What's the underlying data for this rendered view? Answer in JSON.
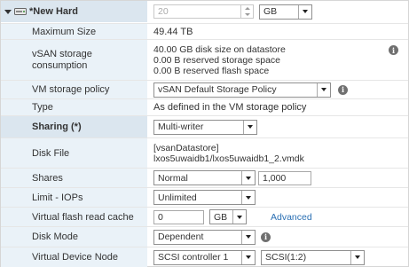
{
  "disk": {
    "title": "*New Hard",
    "size_value": "20",
    "size_unit": "GB"
  },
  "rows": {
    "max_size": {
      "label": "Maximum Size",
      "value": "49.44 TB"
    },
    "vsan": {
      "label_line1": "vSAN storage",
      "label_line2": "consumption",
      "line1": "40.00 GB disk size on datastore",
      "line2": "0.00 B reserved storage space",
      "line3": "0.00 B reserved flash space"
    },
    "policy": {
      "label": "VM storage policy",
      "value": "vSAN Default Storage Policy"
    },
    "type": {
      "label": "Type",
      "value": "As defined in the VM storage policy"
    },
    "sharing": {
      "label": "Sharing (*)",
      "value": "Multi-writer"
    },
    "disk_file": {
      "label": "Disk File",
      "line1": "[vsanDatastore]",
      "line2": "lxos5uwaidb1/lxos5uwaidb1_2.vmdk"
    },
    "shares": {
      "label": "Shares",
      "value": "Normal",
      "amount": "1,000"
    },
    "limit_iops": {
      "label": "Limit - IOPs",
      "value": "Unlimited"
    },
    "flash_cache": {
      "label": "Virtual flash read cache",
      "value": "0",
      "unit": "GB",
      "link": "Advanced"
    },
    "disk_mode": {
      "label": "Disk Mode",
      "value": "Dependent"
    },
    "device_node": {
      "label": "Virtual Device Node",
      "controller": "SCSI controller 1",
      "node": "SCSI(1:2)"
    }
  },
  "info_glyph": "i",
  "colors": {
    "label_bg": "#eaf2f8",
    "section_bg": "#dbe6ef",
    "link": "#2a6fb3"
  }
}
